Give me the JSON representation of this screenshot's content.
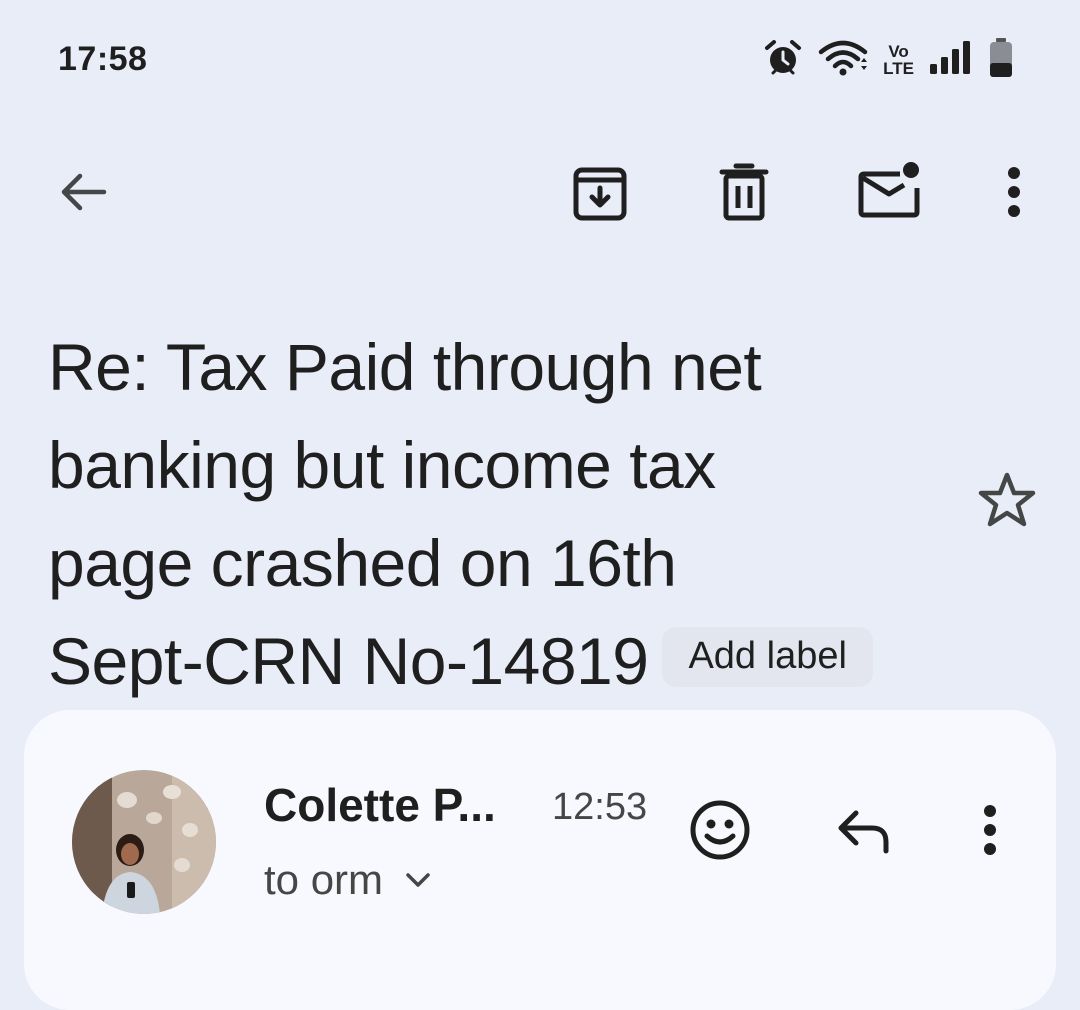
{
  "status_bar": {
    "time": "17:58",
    "icons": [
      "alarm-icon",
      "wifi-icon",
      "volte-icon",
      "signal-icon",
      "battery-icon"
    ],
    "volte_top": "Vo",
    "volte_bottom": "LTE"
  },
  "toolbar": {
    "icons": [
      "back-arrow-icon",
      "archive-icon",
      "delete-icon",
      "mark-unread-icon",
      "more-vert-icon"
    ]
  },
  "email": {
    "subject_lines": [
      "Re: Tax Paid through net",
      "banking but income tax",
      "page crashed on 16th",
      "Sept-CRN No-14819"
    ],
    "add_label": "Add label",
    "star_icon": "star-outline-icon"
  },
  "message": {
    "sender": "Colette P...",
    "time": "12:53",
    "recipient": "to orm",
    "icons": [
      "avatar-photo",
      "emoji-icon",
      "reply-icon",
      "more-vert-icon",
      "chevron-down-icon"
    ]
  },
  "colors": {
    "background": "#e9edf8",
    "card": "#f8f9fe",
    "text_primary": "#1f1f1f",
    "text_secondary": "#444746",
    "chip": "#e3e6ee"
  }
}
